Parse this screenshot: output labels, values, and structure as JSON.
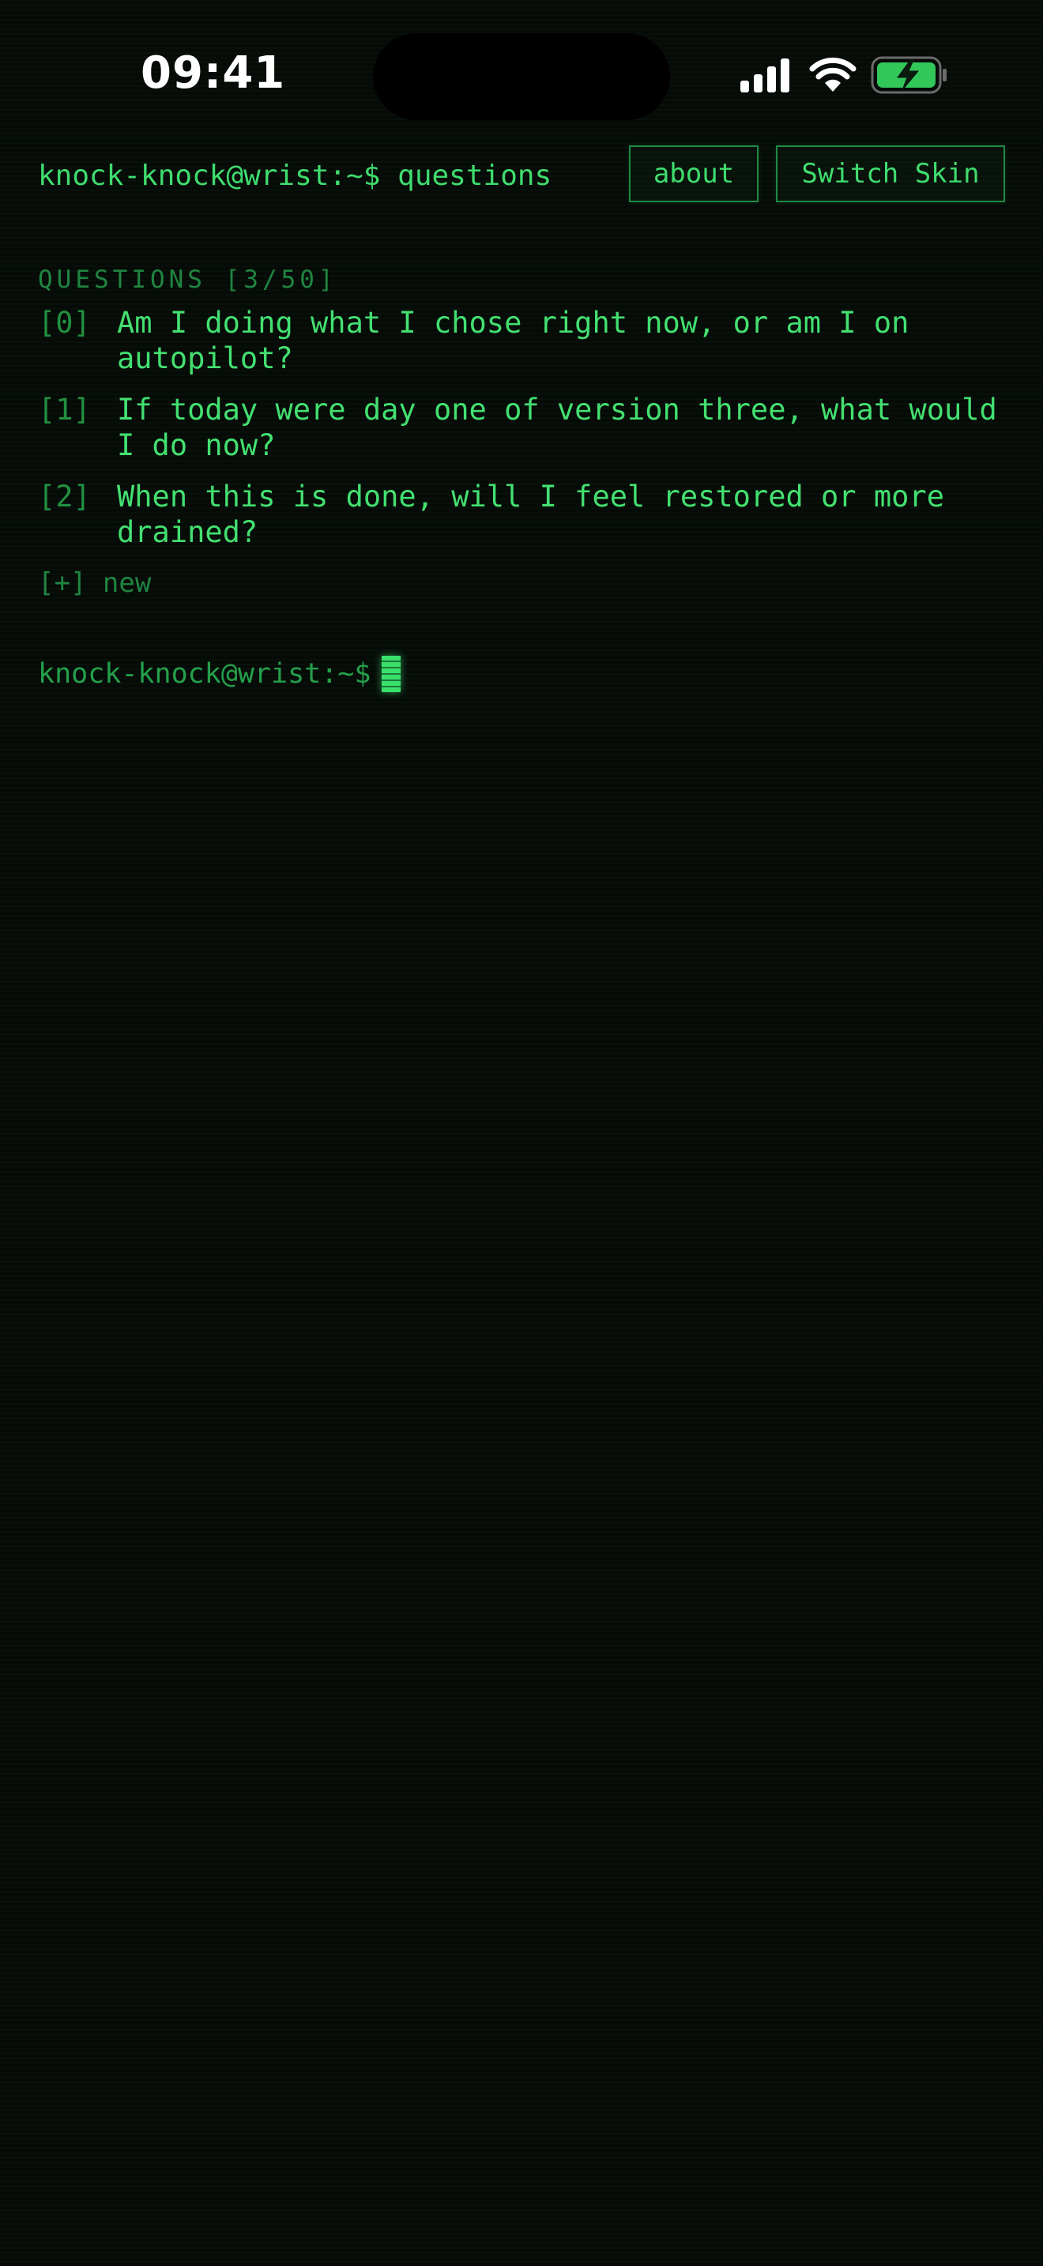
{
  "status_bar": {
    "time": "09:41",
    "icons": [
      "signal-icon",
      "wifi-icon",
      "battery-charging-icon"
    ]
  },
  "header": {
    "prompt": "knock-knock@wrist:~$ questions",
    "about_label": "about",
    "switch_skin_label": "Switch Skin"
  },
  "questions": {
    "title": "QUESTIONS [3/50]",
    "items": [
      {
        "index": "[0]",
        "text": "Am I doing what I chose right now, or am I on autopilot?"
      },
      {
        "index": "[1]",
        "text": "If today were day one of version three, what would I do now?"
      },
      {
        "index": "[2]",
        "text": "When this is done, will I feel restored or more drained?"
      }
    ],
    "new_label": "[+] new"
  },
  "terminal": {
    "prompt": "knock-knock@wrist:~$"
  },
  "colors": {
    "background": "#070b08",
    "primary_green": "#3fdc6e",
    "dim_green": "#1f8540",
    "border_green": "#1e8a44"
  }
}
